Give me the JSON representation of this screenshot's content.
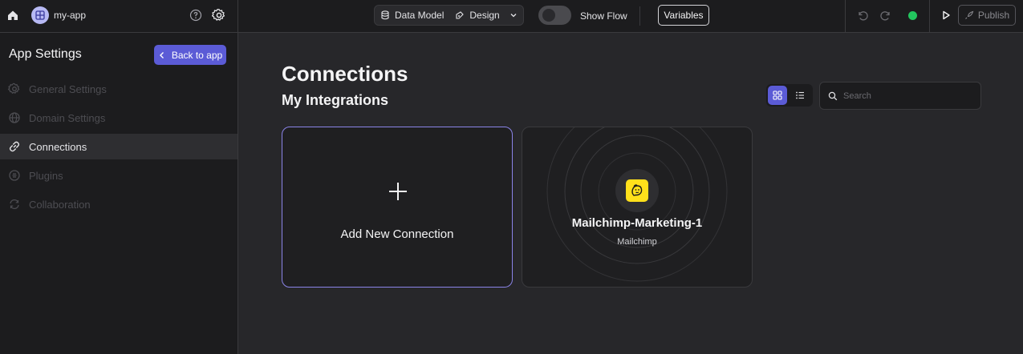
{
  "topbar": {
    "app_name": "my-app",
    "data_model_label": "Data Model",
    "design_label": "Design",
    "show_flow_label": "Show Flow",
    "variables_label": "Variables",
    "publish_label": "Publish",
    "status_color": "#22c55e"
  },
  "sidebar": {
    "title": "App Settings",
    "back_label": "Back to app",
    "items": [
      {
        "label": "General Settings",
        "icon": "gear-icon",
        "active": false
      },
      {
        "label": "Domain Settings",
        "icon": "globe-icon",
        "active": false
      },
      {
        "label": "Connections",
        "icon": "link-icon",
        "active": true
      },
      {
        "label": "Plugins",
        "icon": "plugin-icon",
        "active": false
      },
      {
        "label": "Collaboration",
        "icon": "collaboration-icon",
        "active": false
      }
    ]
  },
  "main": {
    "title": "Connections",
    "subtitle": "My Integrations",
    "search_placeholder": "Search",
    "view_mode": "grid",
    "add_card_label": "Add New Connection",
    "connections": [
      {
        "name": "Mailchimp-Marketing-1",
        "provider": "Mailchimp",
        "logo_color": "#ffe01b"
      }
    ]
  },
  "colors": {
    "accent": "#5b5bd6",
    "background": "#27272a",
    "sidebar_bg": "#1c1c1e"
  }
}
